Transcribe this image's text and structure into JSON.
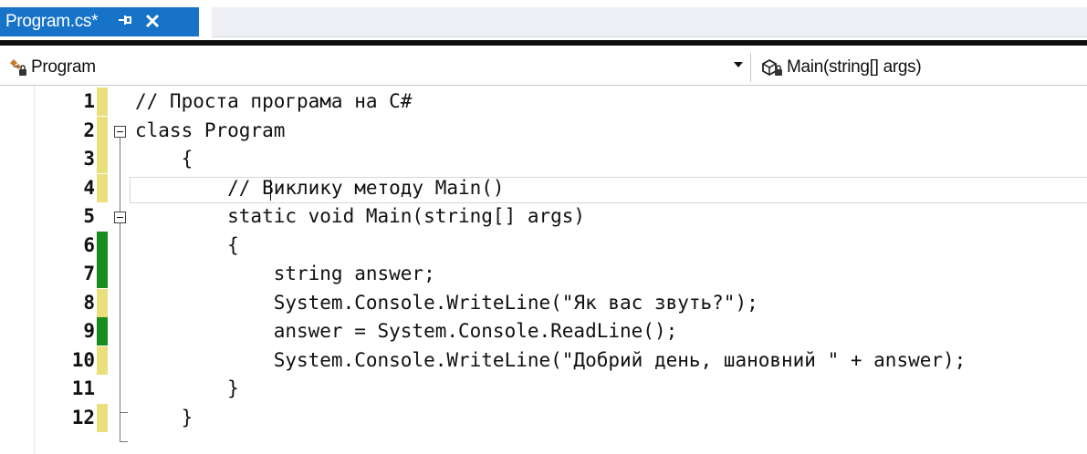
{
  "tab": {
    "title": "Program.cs*",
    "pin_glyph": "⍀",
    "close_glyph": "✕",
    "active_color": "#1773c7"
  },
  "navbar": {
    "type_selector": "Program",
    "member_selector": "Main(string[] args)",
    "type_icon": "class-icon",
    "member_icon": "method-icon"
  },
  "editor": {
    "lines": [
      {
        "num": "1",
        "text": "// Проста програма на C#",
        "change": "yellow"
      },
      {
        "num": "2",
        "text": "class Program",
        "change": "yellow"
      },
      {
        "num": "3",
        "text": "    {",
        "change": "yellow"
      },
      {
        "num": "4",
        "text": "        // Виклику методу Main()",
        "change": "yellow"
      },
      {
        "num": "5",
        "text": "        static void Main(string[] args)",
        "change": "none"
      },
      {
        "num": "6",
        "text": "        {",
        "change": "green"
      },
      {
        "num": "7",
        "text": "            string answer;",
        "change": "green"
      },
      {
        "num": "8",
        "text": "            System.Console.WriteLine(\"Як вас звуть?\");",
        "change": "yellow"
      },
      {
        "num": "9",
        "text": "            answer = System.Console.ReadLine();",
        "change": "green"
      },
      {
        "num": "10",
        "text": "            System.Console.WriteLine(\"Добрий день, шановний \" + answer);",
        "change": "yellow"
      },
      {
        "num": "11",
        "text": "        }",
        "change": "none"
      },
      {
        "num": "12",
        "text": "    }",
        "change": "yellow"
      }
    ]
  }
}
